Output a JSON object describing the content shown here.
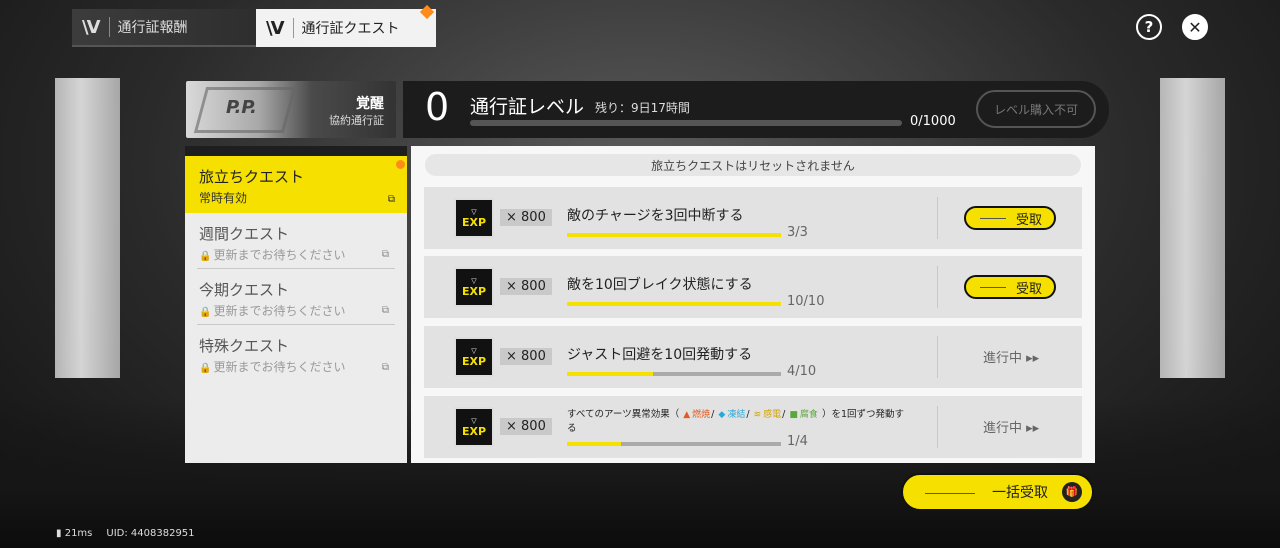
{
  "tabs": [
    {
      "logo": "\\V",
      "label": "通行証報酬"
    },
    {
      "logo": "\\V",
      "label": "通行証クエスト"
    }
  ],
  "top_icons": {
    "help": "?",
    "close": "✕"
  },
  "pass": {
    "logo_text": "P.P.",
    "name": "覚醒",
    "type": "協約通行証"
  },
  "level": {
    "value": "0",
    "title": "通行証レベル",
    "remaining": "残り：9日17時間",
    "progress_fraction": 0,
    "progress_text": "0/1000",
    "buy_label": "レベル購入不可"
  },
  "nav": [
    {
      "title": "旅立ちクエスト",
      "subtitle": "常時有効"
    },
    {
      "title": "週間クエスト",
      "subtitle": "更新までお待ちください"
    },
    {
      "title": "今期クエスト",
      "subtitle": "更新までお待ちください"
    },
    {
      "title": "特殊クエスト",
      "subtitle": "更新までお待ちください"
    }
  ],
  "notice": "旅立ちクエストはリセットされません",
  "quests": [
    {
      "icon_label": "EXP",
      "multiplier": "× 800",
      "title": "敵のチャージを3回中断する",
      "progress": "3/3",
      "fraction": 1.0,
      "action": "受取"
    },
    {
      "icon_label": "EXP",
      "multiplier": "× 800",
      "title": "敵を10回ブレイク状態にする",
      "progress": "10/10",
      "fraction": 1.0,
      "action": "受取"
    },
    {
      "icon_label": "EXP",
      "multiplier": "× 800",
      "title": "ジャスト回避を10回発動する",
      "progress": "4/10",
      "fraction": 0.4,
      "status": "進行中 ▸▸"
    },
    {
      "icon_label": "EXP",
      "multiplier": "× 800",
      "title_parts": {
        "prefix": "すべてのアーツ異常効果（",
        "burn": "燃焼",
        "freeze": "凍結",
        "shock": "感電",
        "corrode": "腐食",
        "suffix": "）を1回ずつ発動する"
      },
      "progress": "1/4",
      "fraction": 0.25,
      "status": "進行中 ▸▸"
    }
  ],
  "claim_all": {
    "label": "一括受取",
    "icon": "🎁"
  },
  "status_bar": {
    "ping": "21ms",
    "uid": "UID: 4408382951"
  },
  "colors": {
    "accent": "#f5e000",
    "notify": "#ff8c1a"
  }
}
